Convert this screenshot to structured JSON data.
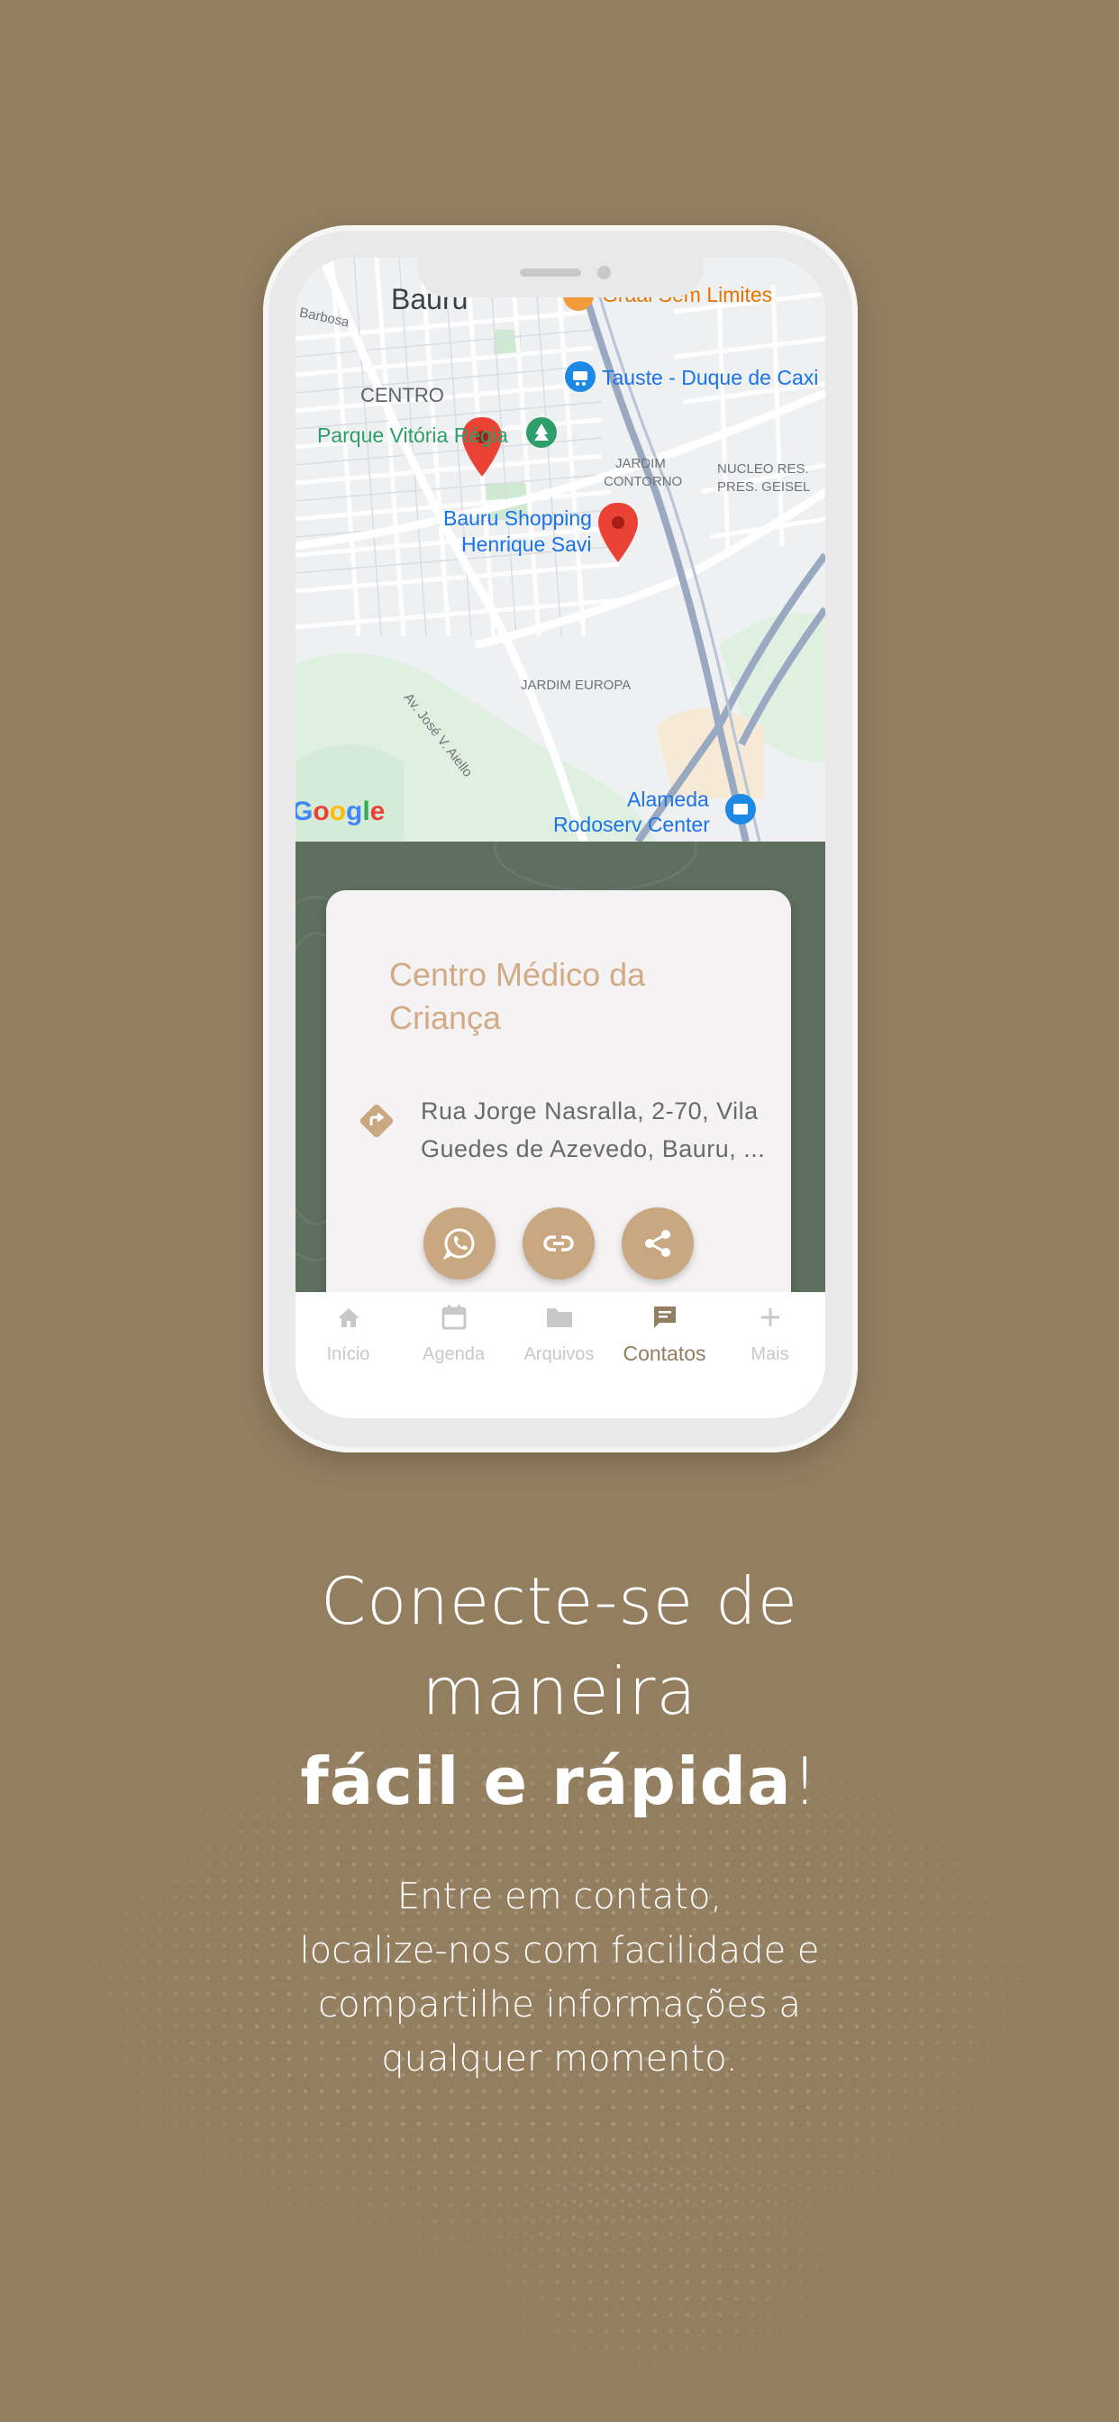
{
  "map": {
    "labels": {
      "city": "Bauru",
      "barbosa": "Barbosa",
      "centro": "CENTRO",
      "park": "Parque Vitória Régia",
      "graal": "Graal Sem Limites",
      "tauste": "Tauste - Duque de Caxi",
      "jardim_contorno_1": "JARDIM",
      "jardim_contorno_2": "CONTORNO",
      "nucleo_1": "NUCLEO RES.",
      "nucleo_2": "PRES. GEISEL",
      "shopping_1": "Bauru Shopping",
      "shopping_2": "Henrique Savi",
      "avenue": "Av. José V. Aiello",
      "jardim_europa": "JARDIM EUROPA",
      "alameda_1": "Alameda",
      "alameda_2": "Rodoserv Center",
      "google": "Google"
    },
    "colors": {
      "pin": "#ea4335",
      "park_marker": "#2e9e6a",
      "shop_marker": "#1e88e5",
      "graal_marker": "#f29b38"
    }
  },
  "card": {
    "title": "Centro Médico da Criança",
    "address_line1": "Rua Jorge Nasralla, 2-70, Vila",
    "address_line2": "Guedes de Azevedo, Bauru, ...",
    "buttons": [
      "whatsapp-icon",
      "link-icon",
      "share-icon"
    ],
    "accent": "#c9a781"
  },
  "nav": {
    "items": [
      {
        "label": "Início",
        "icon": "home-icon"
      },
      {
        "label": "Agenda",
        "icon": "calendar-icon"
      },
      {
        "label": "Arquivos",
        "icon": "folder-icon"
      },
      {
        "label": "Contatos",
        "icon": "chat-icon",
        "active": true
      },
      {
        "label": "Mais",
        "icon": "plus-icon"
      }
    ],
    "active_color": "#937e60"
  },
  "headline": {
    "line1": "Conecte-se de",
    "line2": "maneira",
    "bold": "fácil e rápida",
    "exclaim": "!"
  },
  "subtext": {
    "line1": "Entre em contato,",
    "line2": "localize-nos com facilidade e",
    "line3": "compartilhe informações a",
    "line4": "qualquer momento."
  },
  "colors": {
    "background": "#937e60",
    "panel": "#5e6f5e",
    "card_title": "#d2ab86"
  }
}
